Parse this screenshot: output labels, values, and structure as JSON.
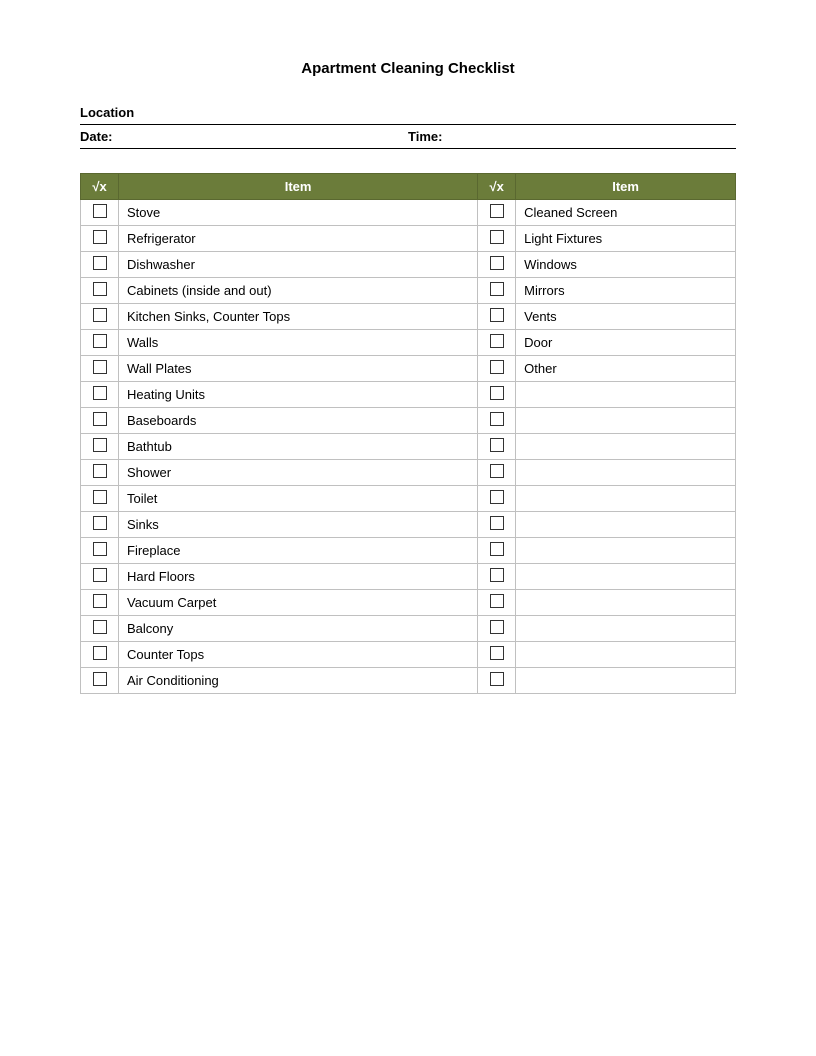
{
  "title": "Apartment Cleaning Checklist",
  "location_label": "Location",
  "date_label": "Date:",
  "time_label": "Time:",
  "table": {
    "col1_header_check": "√x",
    "col1_header_item": "Item",
    "col2_header_check": "√x",
    "col2_header_item": "Item",
    "rows": [
      {
        "left_item": "Stove",
        "right_item": "Cleaned Screen"
      },
      {
        "left_item": "Refrigerator",
        "right_item": "Light Fixtures"
      },
      {
        "left_item": "Dishwasher",
        "right_item": "Windows"
      },
      {
        "left_item": "Cabinets (inside and out)",
        "right_item": "Mirrors"
      },
      {
        "left_item": "Kitchen Sinks, Counter Tops",
        "right_item": "Vents"
      },
      {
        "left_item": "Walls",
        "right_item": "Door"
      },
      {
        "left_item": "Wall Plates",
        "right_item": "Other"
      },
      {
        "left_item": "Heating Units",
        "right_item": ""
      },
      {
        "left_item": "Baseboards",
        "right_item": ""
      },
      {
        "left_item": "Bathtub",
        "right_item": ""
      },
      {
        "left_item": "Shower",
        "right_item": ""
      },
      {
        "left_item": "Toilet",
        "right_item": ""
      },
      {
        "left_item": "Sinks",
        "right_item": ""
      },
      {
        "left_item": "Fireplace",
        "right_item": ""
      },
      {
        "left_item": "Hard Floors",
        "right_item": ""
      },
      {
        "left_item": "Vacuum Carpet",
        "right_item": ""
      },
      {
        "left_item": "Balcony",
        "right_item": ""
      },
      {
        "left_item": "Counter Tops",
        "right_item": ""
      },
      {
        "left_item": "Air Conditioning",
        "right_item": ""
      }
    ]
  }
}
